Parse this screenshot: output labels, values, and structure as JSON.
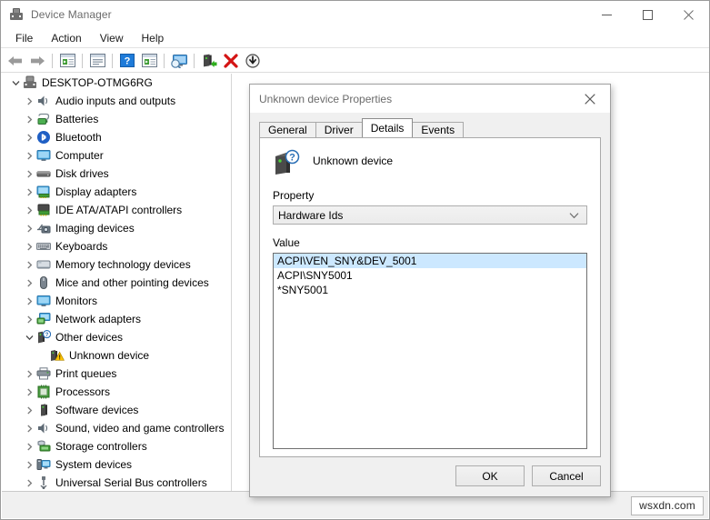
{
  "window": {
    "title": "Device Manager",
    "icon": "device-manager-icon",
    "controls": {
      "minimize": "minimize-icon",
      "maximize": "maximize-icon",
      "close": "close-icon"
    }
  },
  "menu": {
    "items": [
      {
        "label": "File"
      },
      {
        "label": "Action"
      },
      {
        "label": "View"
      },
      {
        "label": "Help"
      }
    ]
  },
  "toolbar": {
    "buttons": [
      {
        "icon": "back-arrow-icon"
      },
      {
        "icon": "forward-arrow-icon"
      },
      {
        "icon": "separator"
      },
      {
        "icon": "show-hidden-devices-icon"
      },
      {
        "icon": "separator"
      },
      {
        "icon": "properties-icon"
      },
      {
        "icon": "separator"
      },
      {
        "icon": "help-icon"
      },
      {
        "icon": "update-driver-icon"
      },
      {
        "icon": "separator"
      },
      {
        "icon": "scan-hardware-changes-icon"
      },
      {
        "icon": "separator"
      },
      {
        "icon": "enable-device-icon"
      },
      {
        "icon": "uninstall-device-icon"
      },
      {
        "icon": "install-legacy-hardware-icon"
      }
    ]
  },
  "tree": {
    "items": [
      {
        "label": "DESKTOP-OTMG6RG",
        "depth": 0,
        "expanded": true,
        "icon": "computer-root-icon"
      },
      {
        "label": "Audio inputs and outputs",
        "depth": 1,
        "expanded": false,
        "icon": "speaker-icon"
      },
      {
        "label": "Batteries",
        "depth": 1,
        "expanded": false,
        "icon": "battery-icon"
      },
      {
        "label": "Bluetooth",
        "depth": 1,
        "expanded": false,
        "icon": "bluetooth-icon"
      },
      {
        "label": "Computer",
        "depth": 1,
        "expanded": false,
        "icon": "monitor-icon"
      },
      {
        "label": "Disk drives",
        "depth": 1,
        "expanded": false,
        "icon": "disk-drive-icon"
      },
      {
        "label": "Display adapters",
        "depth": 1,
        "expanded": false,
        "icon": "display-adapter-icon"
      },
      {
        "label": "IDE ATA/ATAPI controllers",
        "depth": 1,
        "expanded": false,
        "icon": "ide-controller-icon"
      },
      {
        "label": "Imaging devices",
        "depth": 1,
        "expanded": false,
        "icon": "imaging-device-icon"
      },
      {
        "label": "Keyboards",
        "depth": 1,
        "expanded": false,
        "icon": "keyboard-icon"
      },
      {
        "label": "Memory technology devices",
        "depth": 1,
        "expanded": false,
        "icon": "memory-device-icon"
      },
      {
        "label": "Mice and other pointing devices",
        "depth": 1,
        "expanded": false,
        "icon": "mouse-icon"
      },
      {
        "label": "Monitors",
        "depth": 1,
        "expanded": false,
        "icon": "monitor-icon"
      },
      {
        "label": "Network adapters",
        "depth": 1,
        "expanded": false,
        "icon": "network-adapter-icon"
      },
      {
        "label": "Other devices",
        "depth": 1,
        "expanded": true,
        "icon": "other-devices-icon"
      },
      {
        "label": "Unknown device",
        "depth": 2,
        "expanded": null,
        "icon": "unknown-device-warning-icon"
      },
      {
        "label": "Print queues",
        "depth": 1,
        "expanded": false,
        "icon": "printer-icon"
      },
      {
        "label": "Processors",
        "depth": 1,
        "expanded": false,
        "icon": "processor-icon"
      },
      {
        "label": "Software devices",
        "depth": 1,
        "expanded": false,
        "icon": "software-device-icon"
      },
      {
        "label": "Sound, video and game controllers",
        "depth": 1,
        "expanded": false,
        "icon": "speaker-icon"
      },
      {
        "label": "Storage controllers",
        "depth": 1,
        "expanded": false,
        "icon": "storage-controller-icon"
      },
      {
        "label": "System devices",
        "depth": 1,
        "expanded": false,
        "icon": "system-device-icon"
      },
      {
        "label": "Universal Serial Bus controllers",
        "depth": 1,
        "expanded": false,
        "icon": "usb-icon"
      }
    ]
  },
  "status_bar": {
    "text": ""
  },
  "watermark": {
    "text": "wsxdn.com"
  },
  "dialog": {
    "title": "Unknown device Properties",
    "close_icon": "close-icon",
    "tabs": [
      {
        "label": "General",
        "active": false
      },
      {
        "label": "Driver",
        "active": false
      },
      {
        "label": "Details",
        "active": true
      },
      {
        "label": "Events",
        "active": false
      }
    ],
    "device": {
      "name": "Unknown device",
      "icon": "unknown-device-icon"
    },
    "property": {
      "label": "Property",
      "selected": "Hardware Ids",
      "arrow_icon": "chevron-down-icon"
    },
    "value": {
      "label": "Value",
      "rows": [
        {
          "text": "ACPI\\VEN_SNY&DEV_5001",
          "selected": true
        },
        {
          "text": "ACPI\\SNY5001",
          "selected": false
        },
        {
          "text": "*SNY5001",
          "selected": false
        }
      ]
    },
    "buttons": {
      "ok": "OK",
      "cancel": "Cancel"
    }
  },
  "colors": {
    "selection_blue": "#cce8ff",
    "window_bg": "#ffffff",
    "dialog_bg": "#f0f0f0",
    "status_bg": "#f0f0f0",
    "title_text": "#6b6b6b",
    "warning_yellow": "#ffc400",
    "error_red": "#d41414",
    "accent_green": "#35a01c"
  }
}
